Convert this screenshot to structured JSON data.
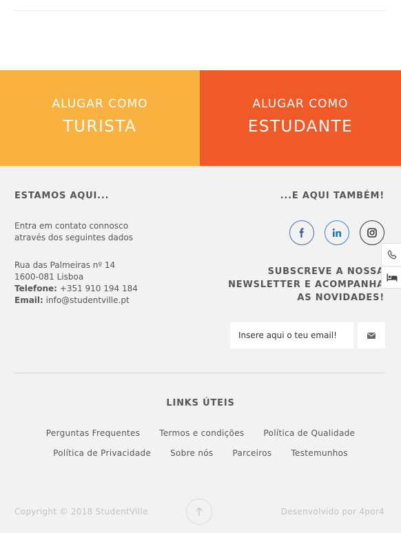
{
  "cta": {
    "turista": {
      "small": "ALUGAR COMO",
      "big": "TURISTA"
    },
    "estudante": {
      "small": "ALUGAR COMO",
      "big": "ESTUDANTE"
    }
  },
  "footer": {
    "left_heading": "ESTAMOS AQUI...",
    "right_heading": "...E AQUI TAMBÉM!",
    "intro_line1": "Entra em contato connosco",
    "intro_line2": "através dos seguintes dados",
    "address_line1": "Rua das Palmeiras nº 14",
    "address_line2": "1600-081 Lisboa",
    "phone_label": "Telefone:",
    "phone_value": "+351 910 194 184",
    "email_label": "Email:",
    "email_value": "info@studentville.pt",
    "newsletter_line1": "SUBSCREVE A NOSSA",
    "newsletter_line2": "NEWSLETTER E ACOMPANHA",
    "newsletter_line3": "AS NOVIDADES!",
    "email_placeholder": "Insere aqui o teu email!",
    "links_title": "LINKS ÚTEIS",
    "links_row1": [
      "Perguntas Frequentes",
      "Termos e condições",
      "Política de Qualidade"
    ],
    "links_row2": [
      "Política de Privacidade",
      "Sobre nós",
      "Parceiros",
      "Testemunhos"
    ],
    "copyright": "Copyright © 2018 StudentVille",
    "developed_by": "Desenvolvido por 4por4"
  },
  "icons": {
    "social": [
      "facebook-icon",
      "linkedin-icon",
      "instagram-icon"
    ],
    "float": [
      "phone-icon",
      "bed-icon"
    ],
    "send": "mail-icon",
    "scroll": "arrow-up-icon"
  },
  "colors": {
    "turista": "#f9b13f",
    "estudante": "#f05a28",
    "footer_bg": "#f2f2f2",
    "facebook": "#3b5998",
    "linkedin": "#1b76b4"
  }
}
